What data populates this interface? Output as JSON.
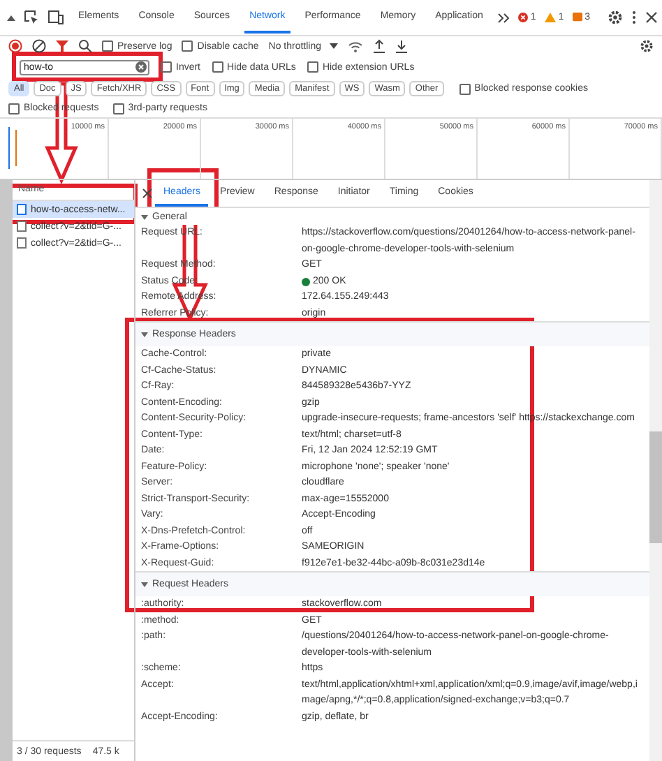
{
  "devtools_tabs": [
    {
      "label": "Elements",
      "selected": false
    },
    {
      "label": "Console",
      "selected": false
    },
    {
      "label": "Sources",
      "selected": false
    },
    {
      "label": "Network",
      "selected": true
    },
    {
      "label": "Performance",
      "selected": false
    },
    {
      "label": "Memory",
      "selected": false
    },
    {
      "label": "Application",
      "selected": false
    }
  ],
  "counters": [
    {
      "kind": "error",
      "count": "1"
    },
    {
      "kind": "warning",
      "count": "1"
    },
    {
      "kind": "issue",
      "count": "3"
    }
  ],
  "toolbar": {
    "preserve_log": {
      "label": "Preserve log",
      "checked": false
    },
    "disable_cache": {
      "label": "Disable cache",
      "checked": false
    },
    "throttling": "No throttling"
  },
  "filter": {
    "value": "how-to",
    "options": [
      {
        "label": "Invert",
        "checked": false
      },
      {
        "label": "Hide data URLs",
        "checked": false
      },
      {
        "label": "Hide extension URLs",
        "checked": false
      }
    ]
  },
  "type_filters": [
    {
      "label": "All",
      "selected": true
    },
    {
      "label": "Doc",
      "selected": false
    },
    {
      "label": "JS",
      "selected": false
    },
    {
      "label": "Fetch/XHR",
      "selected": false
    },
    {
      "label": "CSS",
      "selected": false
    },
    {
      "label": "Font",
      "selected": false
    },
    {
      "label": "Img",
      "selected": false
    },
    {
      "label": "Media",
      "selected": false
    },
    {
      "label": "Manifest",
      "selected": false
    },
    {
      "label": "WS",
      "selected": false
    },
    {
      "label": "Wasm",
      "selected": false
    },
    {
      "label": "Other",
      "selected": false
    }
  ],
  "blocked_response_cookies": {
    "label": "Blocked response cookies",
    "checked": false
  },
  "extra_options": [
    {
      "label": "Blocked requests",
      "checked": false
    },
    {
      "label": "3rd-party requests",
      "checked": false
    }
  ],
  "timeline": {
    "ticks": [
      "10000 ms",
      "20000 ms",
      "30000 ms",
      "40000 ms",
      "50000 ms",
      "60000 ms",
      "70000 ms"
    ]
  },
  "requests": {
    "header": "Name",
    "items": [
      {
        "name": "how-to-access-netw...",
        "selected": true
      },
      {
        "name": "collect?v=2&tid=G-...",
        "selected": false
      },
      {
        "name": "collect?v=2&tid=G-...",
        "selected": false
      }
    ]
  },
  "status_bar": {
    "requests": "3 / 30 requests",
    "transferred": "47.5 k"
  },
  "detail_tabs": [
    {
      "label": "Headers",
      "selected": true
    },
    {
      "label": "Preview",
      "selected": false
    },
    {
      "label": "Response",
      "selected": false
    },
    {
      "label": "Initiator",
      "selected": false
    },
    {
      "label": "Timing",
      "selected": false
    },
    {
      "label": "Cookies",
      "selected": false
    }
  ],
  "sections": [
    {
      "title": "General",
      "expanded": true,
      "rows": [
        {
          "name": "Request URL:",
          "value": "https://stackoverflow.com/questions/20401264/how-to-access-network-panel-on-google-chrome-developer-tools-with-selenium"
        },
        {
          "name": "Request Method:",
          "value": "GET"
        },
        {
          "name": "Status Code:",
          "value": "200 OK",
          "color": "#188038"
        },
        {
          "name": "Remote Address:",
          "value": "172.64.155.249:443"
        },
        {
          "name": "Referrer Policy:",
          "value": "origin"
        }
      ]
    },
    {
      "title": "Response Headers",
      "expanded": true,
      "rows": [
        {
          "name": "Cache-Control:",
          "value": "private"
        },
        {
          "name": "Cf-Cache-Status:",
          "value": "DYNAMIC"
        },
        {
          "name": "Cf-Ray:",
          "value": "844589328e5436b7-YYZ"
        },
        {
          "name": "Content-Encoding:",
          "value": "gzip"
        },
        {
          "name": "Content-Security-Policy:",
          "value": "upgrade-insecure-requests; frame-ancestors 'self' https://stackexchange.com"
        },
        {
          "name": "Content-Type:",
          "value": "text/html; charset=utf-8"
        },
        {
          "name": "Date:",
          "value": "Fri, 12 Jan 2024 12:52:19 GMT"
        },
        {
          "name": "Feature-Policy:",
          "value": "microphone 'none'; speaker 'none'"
        },
        {
          "name": "Server:",
          "value": "cloudflare"
        },
        {
          "name": "Strict-Transport-Security:",
          "value": "max-age=15552000"
        },
        {
          "name": "Vary:",
          "value": "Accept-Encoding"
        },
        {
          "name": "X-Dns-Prefetch-Control:",
          "value": "off"
        },
        {
          "name": "X-Frame-Options:",
          "value": "SAMEORIGIN"
        },
        {
          "name": "X-Request-Guid:",
          "value": "f912e7e1-be32-44bc-a09b-8c031e23d14e"
        }
      ]
    },
    {
      "title": "Request Headers",
      "expanded": true,
      "rows": [
        {
          "name": ":authority:",
          "value": "stackoverflow.com"
        },
        {
          "name": ":method:",
          "value": "GET"
        },
        {
          "name": ":path:",
          "value": "/questions/20401264/how-to-access-network-panel-on-google-chrome-developer-tools-with-selenium"
        },
        {
          "name": ":scheme:",
          "value": "https"
        },
        {
          "name": "Accept:",
          "value": "text/html,application/xhtml+xml,application/xml;q=0.9,image/avif,image/webp,image/apng,*/*;q=0.8,application/signed-exchange;v=b3;q=0.7"
        },
        {
          "name": "Accept-Encoding:",
          "value": "gzip, deflate, br"
        }
      ]
    }
  ]
}
